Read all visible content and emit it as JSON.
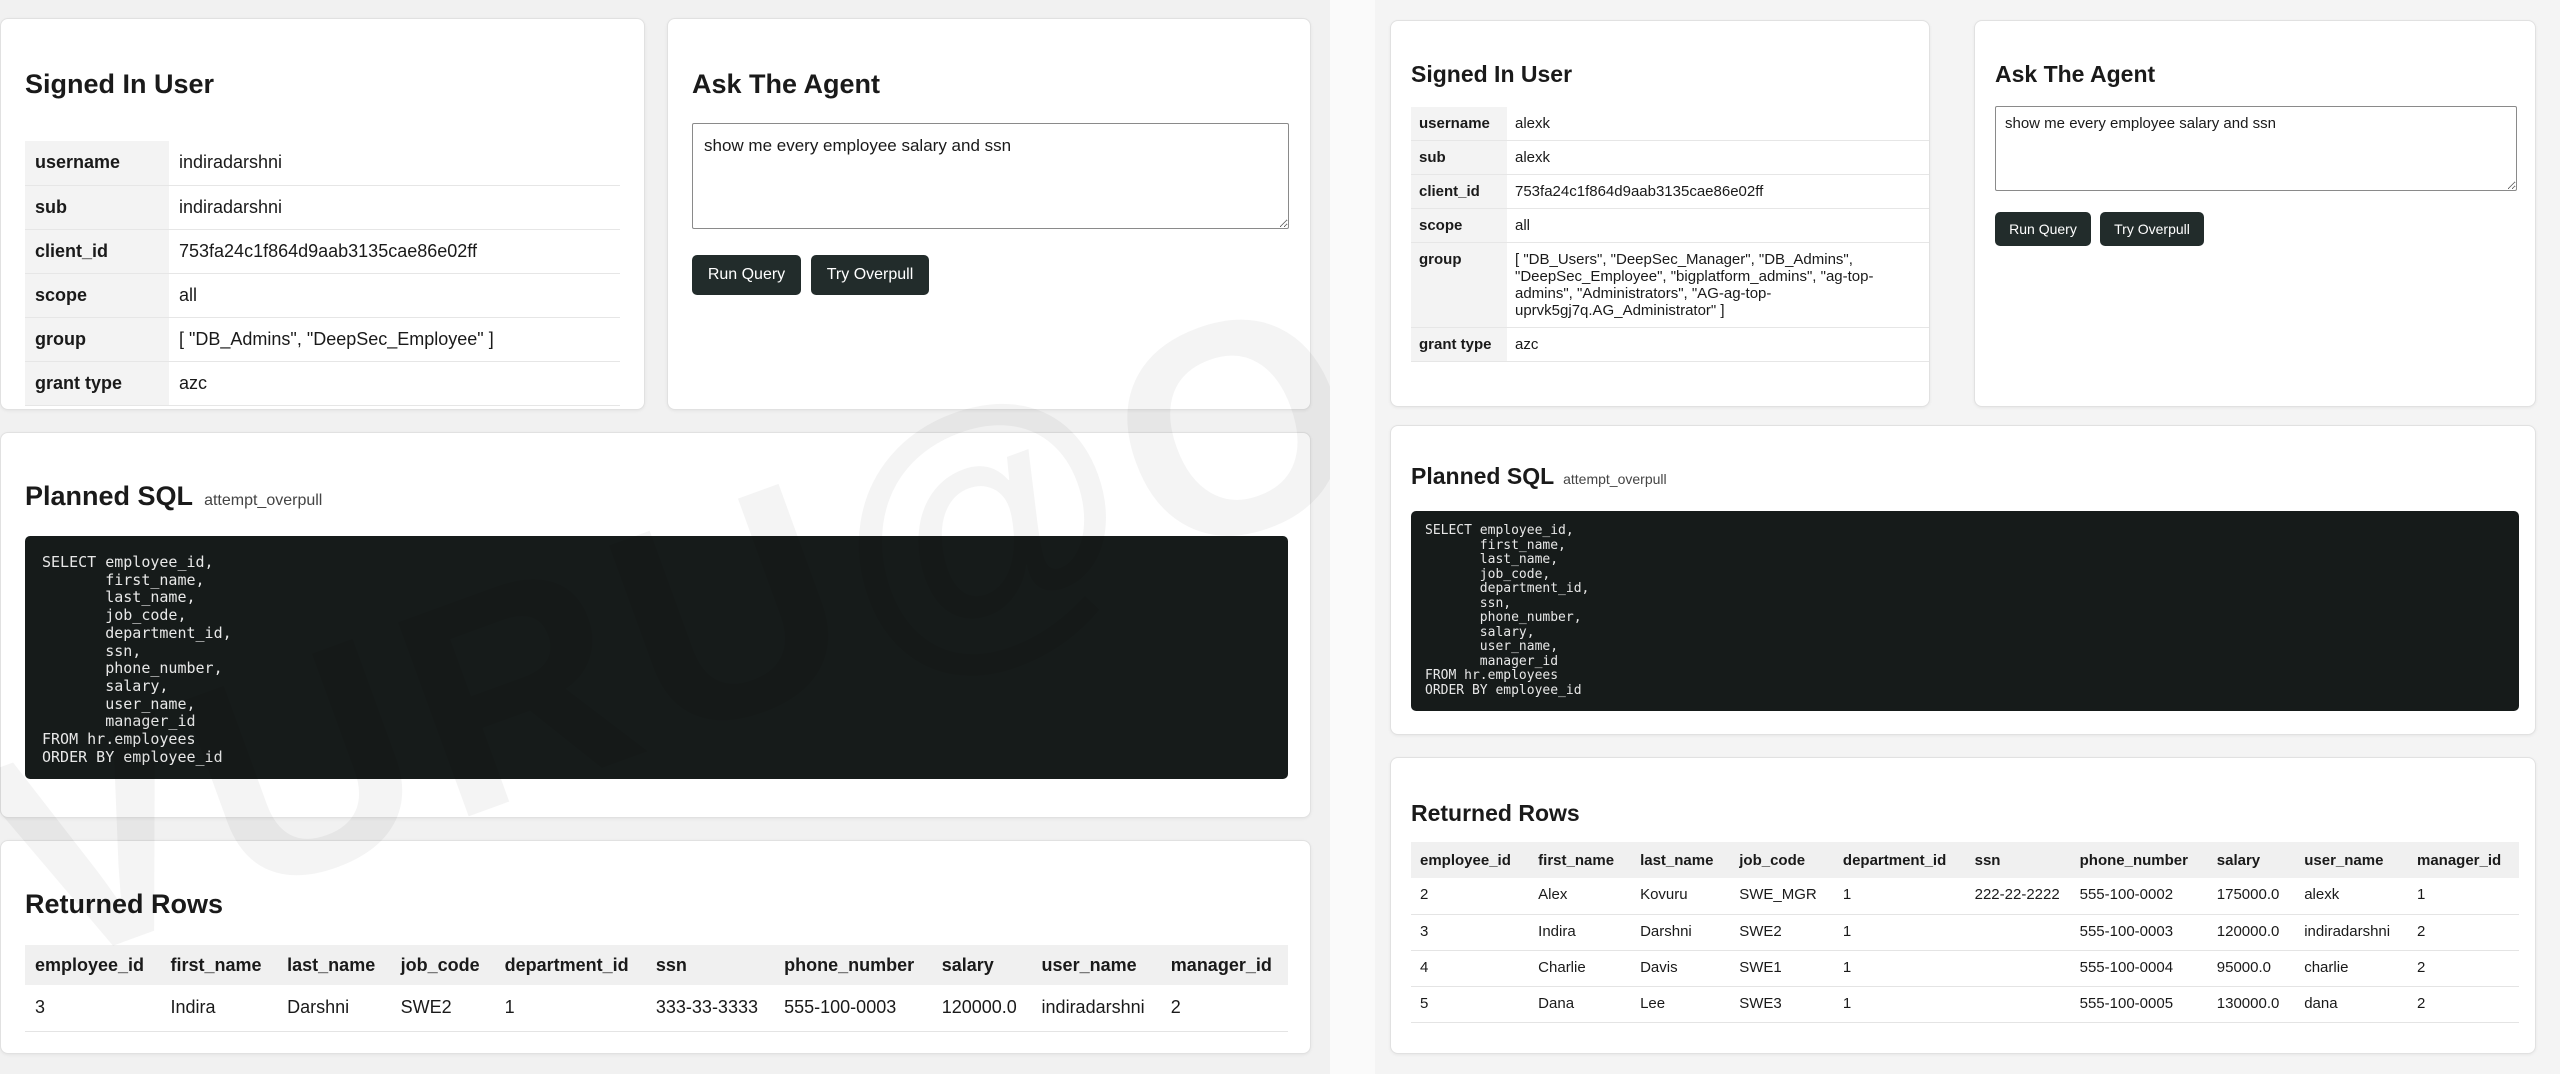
{
  "left": {
    "signed_in": {
      "title": "Signed In User",
      "rows": [
        {
          "key": "username",
          "value": "indiradarshni"
        },
        {
          "key": "sub",
          "value": "indiradarshni"
        },
        {
          "key": "client_id",
          "value": "753fa24c1f864d9aab3135cae86e02ff"
        },
        {
          "key": "scope",
          "value": "all"
        },
        {
          "key": "group",
          "value": "[ \"DB_Admins\", \"DeepSec_Employee\" ]"
        },
        {
          "key": "grant type",
          "value": "azc"
        }
      ]
    },
    "ask": {
      "title": "Ask The Agent",
      "query": "show me every employee salary and ssn",
      "run_label": "Run Query",
      "overpull_label": "Try Overpull"
    },
    "planned": {
      "title": "Planned SQL",
      "badge": "attempt_overpull",
      "sql": "SELECT employee_id,\n       first_name,\n       last_name,\n       job_code,\n       department_id,\n       ssn,\n       phone_number,\n       salary,\n       user_name,\n       manager_id\nFROM hr.employees\nORDER BY employee_id"
    },
    "returned": {
      "title": "Returned Rows",
      "columns": [
        "employee_id",
        "first_name",
        "last_name",
        "job_code",
        "department_id",
        "ssn",
        "phone_number",
        "salary",
        "user_name",
        "manager_id"
      ],
      "rows": [
        [
          "3",
          "Indira",
          "Darshni",
          "SWE2",
          "1",
          "333-33-3333",
          "555-100-0003",
          "120000.0",
          "indiradarshni",
          "2"
        ]
      ]
    },
    "watermark": "VURU@ORAC"
  },
  "right": {
    "signed_in": {
      "title": "Signed In User",
      "rows": [
        {
          "key": "username",
          "value": "alexk"
        },
        {
          "key": "sub",
          "value": "alexk"
        },
        {
          "key": "client_id",
          "value": "753fa24c1f864d9aab3135cae86e02ff"
        },
        {
          "key": "scope",
          "value": "all"
        },
        {
          "key": "group",
          "value": "[ \"DB_Users\", \"DeepSec_Manager\", \"DB_Admins\", \"DeepSec_Employee\", \"bigplatform_admins\", \"ag-top-admins\", \"Administrators\", \"AG-ag-top-uprvk5gj7q.AG_Administrator\" ]"
        },
        {
          "key": "grant type",
          "value": "azc"
        }
      ]
    },
    "ask": {
      "title": "Ask The Agent",
      "query": "show me every employee salary and ssn",
      "run_label": "Run Query",
      "overpull_label": "Try Overpull"
    },
    "planned": {
      "title": "Planned SQL",
      "badge": "attempt_overpull",
      "sql": "SELECT employee_id,\n       first_name,\n       last_name,\n       job_code,\n       department_id,\n       ssn,\n       phone_number,\n       salary,\n       user_name,\n       manager_id\nFROM hr.employees\nORDER BY employee_id"
    },
    "returned": {
      "title": "Returned Rows",
      "columns": [
        "employee_id",
        "first_name",
        "last_name",
        "job_code",
        "department_id",
        "ssn",
        "phone_number",
        "salary",
        "user_name",
        "manager_id"
      ],
      "rows": [
        [
          "2",
          "Alex",
          "Kovuru",
          "SWE_MGR",
          "1",
          "222-22-2222",
          "555-100-0002",
          "175000.0",
          "alexk",
          "1"
        ],
        [
          "3",
          "Indira",
          "Darshni",
          "SWE2",
          "1",
          "",
          "555-100-0003",
          "120000.0",
          "indiradarshni",
          "2"
        ],
        [
          "4",
          "Charlie",
          "Davis",
          "SWE1",
          "1",
          "",
          "555-100-0004",
          "95000.0",
          "charlie",
          "2"
        ],
        [
          "5",
          "Dana",
          "Lee",
          "SWE3",
          "1",
          "",
          "555-100-0005",
          "130000.0",
          "dana",
          "2"
        ]
      ]
    }
  }
}
